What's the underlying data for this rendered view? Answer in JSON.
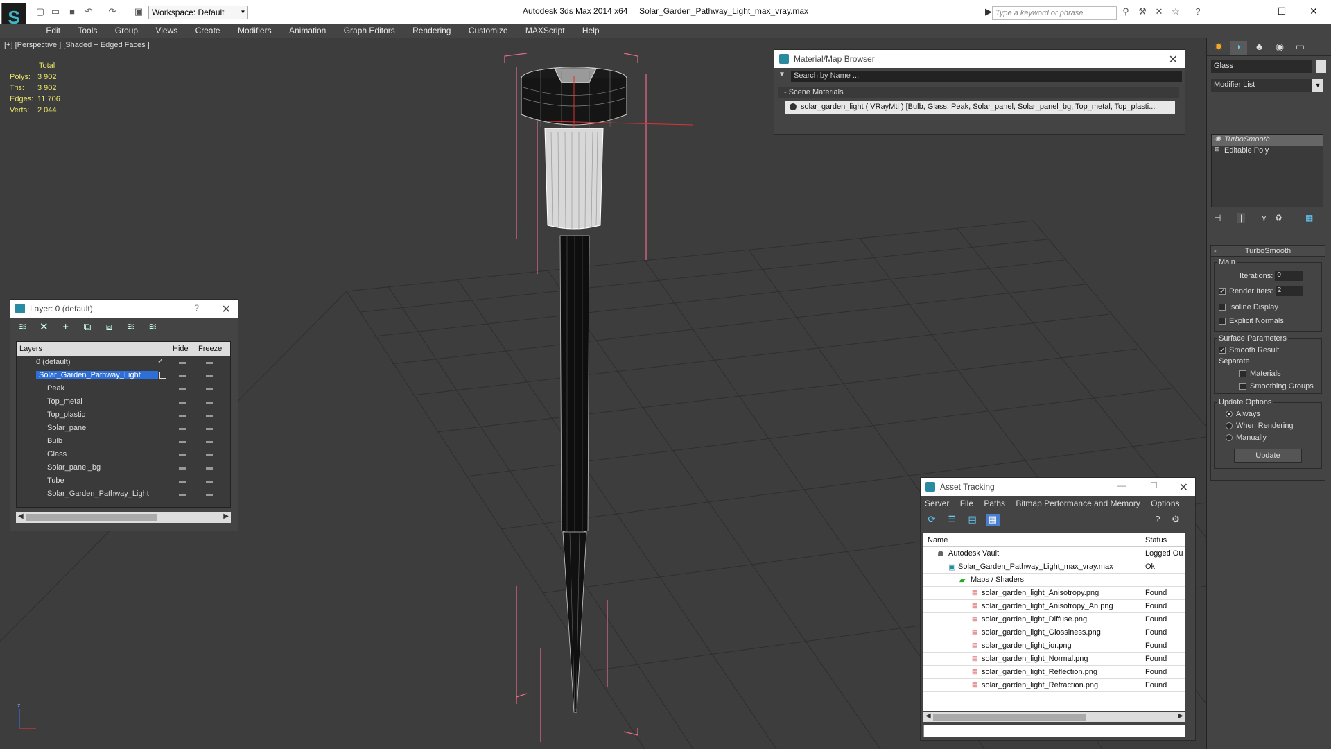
{
  "app": {
    "name": "Autodesk 3ds Max  2014 x64",
    "file": "Solar_Garden_Pathway_Light_max_vray.max",
    "workspace": "Workspace: Default",
    "search_placeholder": "Type a keyword or phrase"
  },
  "menu": [
    "Edit",
    "Tools",
    "Group",
    "Views",
    "Create",
    "Modifiers",
    "Animation",
    "Graph Editors",
    "Rendering",
    "Customize",
    "MAXScript",
    "Help"
  ],
  "viewport": {
    "label": "[+] [Perspective ] [Shaded + Edged Faces ]",
    "stats": {
      "header": "Total",
      "rows": [
        {
          "label": "Polys:",
          "value": "3 902"
        },
        {
          "label": "Tris:",
          "value": "3 902"
        },
        {
          "label": "Edges:",
          "value": "11 706"
        },
        {
          "label": "Verts:",
          "value": "2 044"
        }
      ]
    },
    "axis_labels": {
      "z": "z",
      "x": "x"
    }
  },
  "layer_panel": {
    "title": "Layer: 0 (default)",
    "help": "?",
    "columns": {
      "layers": "Layers",
      "hide": "Hide",
      "freeze": "Freeze"
    },
    "rows": [
      {
        "name": "0 (default)"
      },
      {
        "name": "Solar_Garden_Pathway_Light"
      },
      {
        "name": "Peak"
      },
      {
        "name": "Top_metal"
      },
      {
        "name": "Top_plastic"
      },
      {
        "name": "Solar_panel"
      },
      {
        "name": "Bulb"
      },
      {
        "name": "Glass"
      },
      {
        "name": "Solar_panel_bg"
      },
      {
        "name": "Tube"
      },
      {
        "name": "Solar_Garden_Pathway_Light"
      }
    ]
  },
  "material_browser": {
    "title": "Material/Map Browser",
    "search": "Search by Name ...",
    "section": "Scene Materials",
    "item": "solar_garden_light  ( VRayMtl ) [Bulb, Glass, Peak, Solar_panel, Solar_panel_bg, Top_metal, Top_plasti...",
    "item_end": "..."
  },
  "asset_tracking": {
    "title": "Asset Tracking",
    "menu": [
      "Server",
      "File",
      "Paths",
      "Bitmap Performance and Memory",
      "Options"
    ],
    "columns": {
      "name": "Name",
      "status": "Status"
    },
    "rows": [
      {
        "name": "Autodesk Vault",
        "status": "Logged Ou"
      },
      {
        "name": "Solar_Garden_Pathway_Light_max_vray.max",
        "status": "Ok"
      },
      {
        "name": "Maps / Shaders",
        "status": ""
      },
      {
        "name": "solar_garden_light_Anisotropy.png",
        "status": "Found"
      },
      {
        "name": "solar_garden_light_Anisotropy_An.png",
        "status": "Found"
      },
      {
        "name": "solar_garden_light_Diffuse.png",
        "status": "Found"
      },
      {
        "name": "solar_garden_light_Glossiness.png",
        "status": "Found"
      },
      {
        "name": "solar_garden_light_ior.png",
        "status": "Found"
      },
      {
        "name": "solar_garden_light_Normal.png",
        "status": "Found"
      },
      {
        "name": "solar_garden_light_Reflection.png",
        "status": "Found"
      },
      {
        "name": "solar_garden_light_Refraction.png",
        "status": "Found"
      }
    ]
  },
  "command_panel": {
    "object_name": "Glass",
    "modifier_list": "Modifier List",
    "stack": [
      "TurboSmooth",
      "Editable Poly"
    ],
    "rollout_title": "TurboSmooth",
    "main": {
      "label": "Main",
      "iterations_label": "Iterations:",
      "iterations_value": "0",
      "render_iters_label": "Render Iters:",
      "render_iters_value": "2",
      "isoline": "Isoline Display",
      "explicit_normals": "Explicit Normals"
    },
    "surface": {
      "label": "Surface Parameters",
      "smooth_result": "Smooth Result",
      "separate": "Separate",
      "materials": "Materials",
      "smoothing_groups": "Smoothing Groups"
    },
    "update": {
      "label": "Update Options",
      "always": "Always",
      "when_rendering": "When Rendering",
      "manually": "Manually",
      "button": "Update"
    }
  }
}
